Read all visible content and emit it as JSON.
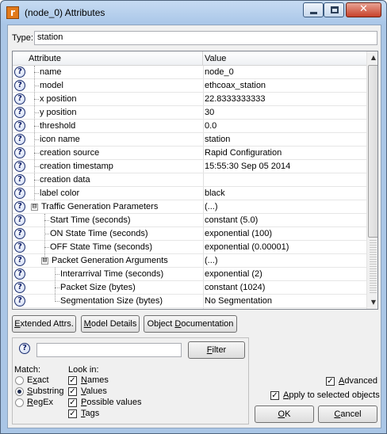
{
  "window": {
    "title": "(node_0) Attributes",
    "app_icon_glyph": "r",
    "controls": {
      "minimize": "minimize-icon",
      "maximize": "maximize-icon",
      "close": "close-icon"
    }
  },
  "type_field": {
    "label": "Type:",
    "value": "station"
  },
  "table": {
    "headers": {
      "attribute": "Attribute",
      "value": "Value"
    },
    "rows": [
      {
        "name": "name",
        "value": "node_0"
      },
      {
        "name": "model",
        "value": "ethcoax_station"
      },
      {
        "name": "x position",
        "value": "22.8333333333"
      },
      {
        "name": "y position",
        "value": "30"
      },
      {
        "name": "threshold",
        "value": "0.0"
      },
      {
        "name": "icon name",
        "value": "station"
      },
      {
        "name": "creation source",
        "value": "Rapid Configuration"
      },
      {
        "name": "creation timestamp",
        "value": "15:55:30 Sep 05 2014"
      },
      {
        "name": "creation data",
        "value": ""
      },
      {
        "name": "label color",
        "value": "black"
      },
      {
        "name": "Traffic Generation Parameters",
        "value": "(...)",
        "expander": "⊟"
      },
      {
        "name": "Start Time (seconds)",
        "value": "constant (5.0)"
      },
      {
        "name": "ON State Time (seconds)",
        "value": "exponential (100)"
      },
      {
        "name": "OFF State Time (seconds)",
        "value": "exponential (0.00001)"
      },
      {
        "name": "Packet Generation Arguments",
        "value": "(...)",
        "expander": "⊟"
      },
      {
        "name": "Interarrival Time (seconds)",
        "value": "exponential (2)"
      },
      {
        "name": "Packet Size (bytes)",
        "value": "constant (1024)"
      },
      {
        "name": "Segmentation Size (bytes)",
        "value": "No Segmentation"
      }
    ],
    "help_glyph": "?",
    "scroll_up": "▲",
    "scroll_down": "▼"
  },
  "buttons": {
    "extended_attrs": "Extended Attrs.",
    "model_details": "Model Details",
    "object_documentation": "Object Documentation",
    "filter": "Filter",
    "ok": "OK",
    "cancel": "Cancel"
  },
  "filter": {
    "help_glyph": "?",
    "input_value": "",
    "match_label": "Match:",
    "match_options": [
      {
        "label": "Exact",
        "selected": false
      },
      {
        "label": "Substring",
        "selected": true
      },
      {
        "label": "RegEx",
        "selected": false
      }
    ],
    "look_in_label": "Look in:",
    "look_in_options": [
      {
        "label": "Names",
        "checked": true
      },
      {
        "label": "Values",
        "checked": true
      },
      {
        "label": "Possible values",
        "checked": true
      },
      {
        "label": "Tags",
        "checked": true
      }
    ]
  },
  "options": {
    "advanced": {
      "label": "Advanced",
      "checked": true
    },
    "apply_to_selected": {
      "label": "Apply to selected objects",
      "checked": true
    }
  },
  "check_glyph": "✓"
}
